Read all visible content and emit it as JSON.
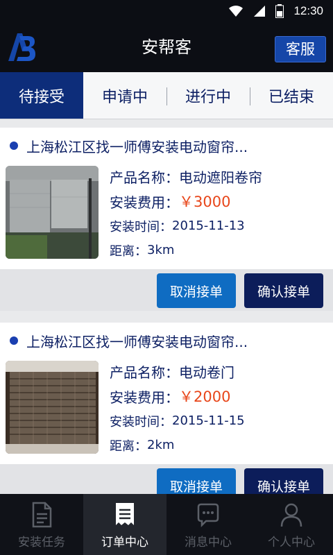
{
  "statusbar": {
    "time": "12:30",
    "icons": [
      "wifi-icon",
      "signal-icon",
      "battery-icon"
    ]
  },
  "header": {
    "title": "安帮客",
    "service_label": "客服",
    "logo_icon": "ab-logo-icon"
  },
  "tabs": [
    {
      "label": "待接受",
      "active": true
    },
    {
      "label": "申请中",
      "active": false
    },
    {
      "label": "进行中",
      "active": false
    },
    {
      "label": "已结束",
      "active": false
    }
  ],
  "orders": [
    {
      "title": "上海松江区找一师傅安装电动窗帘...",
      "product_label": "产品名称：",
      "product": "电动遮阳卷帘",
      "fee_label": "安装费用：",
      "fee": "￥3000",
      "time_label": "安装时间：",
      "time": "2015-11-13",
      "distance_label": "距离：",
      "distance": "3km",
      "cancel_label": "取消接单",
      "confirm_label": "确认接单"
    },
    {
      "title": "上海松江区找一师傅安装电动窗帘...",
      "product_label": "产品名称：",
      "product": "电动卷门",
      "fee_label": "安装费用：",
      "fee": "￥2000",
      "time_label": "安装时间：",
      "time": "2015-11-15",
      "distance_label": "距离：",
      "distance": "2km",
      "cancel_label": "取消接单",
      "confirm_label": "确认接单"
    }
  ],
  "bottom_nav": [
    {
      "label": "安装任务",
      "icon": "document-icon",
      "active": false
    },
    {
      "label": "订单中心",
      "icon": "receipt-icon",
      "active": true
    },
    {
      "label": "消息中心",
      "icon": "chat-bubble-icon",
      "active": false
    },
    {
      "label": "个人中心",
      "icon": "person-icon",
      "active": false
    }
  ],
  "colors": {
    "accent": "#0d2d7a",
    "price": "#e8461a",
    "cancel_btn": "#0f6cc2",
    "confirm_btn": "#0c1d5a"
  }
}
